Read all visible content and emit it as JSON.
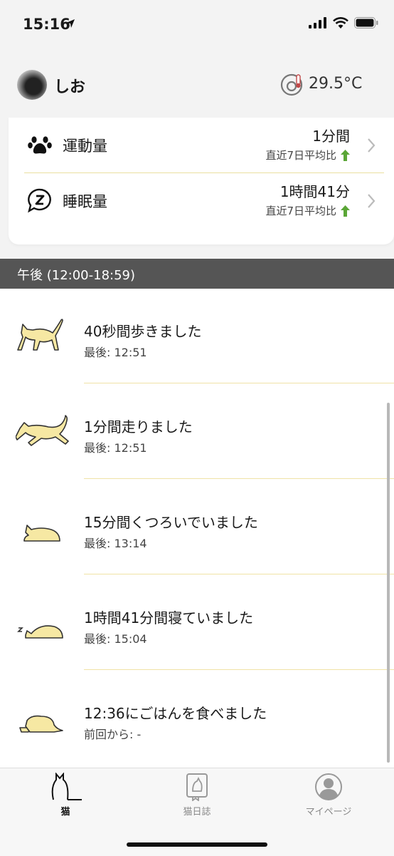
{
  "status_bar": {
    "time": "15:16"
  },
  "header": {
    "cat_name": "しお",
    "temperature": "29.5°C"
  },
  "summary": {
    "activity": {
      "label": "運動量",
      "value": "1分間",
      "comparison": "直近7日平均比"
    },
    "sleep": {
      "label": "睡眠量",
      "value": "1時間41分",
      "comparison": "直近7日平均比"
    }
  },
  "section": {
    "title": "午後 (12:00-18:59)"
  },
  "timeline": {
    "items": [
      {
        "icon": "cat-walking-icon",
        "title": "40秒間歩きました",
        "sub": "最後: 12:51"
      },
      {
        "icon": "cat-running-icon",
        "title": "1分間走りました",
        "sub": "最後: 12:51"
      },
      {
        "icon": "cat-resting-icon",
        "title": "15分間くつろいでいました",
        "sub": "最後: 13:14"
      },
      {
        "icon": "cat-sleeping-icon",
        "title": "1時間41分間寝ていました",
        "sub": "最後: 15:04"
      },
      {
        "icon": "cat-eating-icon",
        "title": "12:36にごはんを食べました",
        "sub": "前回から: -"
      }
    ]
  },
  "tabs": [
    {
      "label": "猫",
      "icon": "cat-tab-icon",
      "active": true
    },
    {
      "label": "猫日誌",
      "icon": "diary-tab-icon",
      "active": false
    },
    {
      "label": "マイページ",
      "icon": "person-tab-icon",
      "active": false
    }
  ],
  "colors": {
    "accent_yellow": "#f6e8a3",
    "icon_outline": "#333333",
    "up_green": "#5aa636",
    "section_bg": "#555555"
  }
}
